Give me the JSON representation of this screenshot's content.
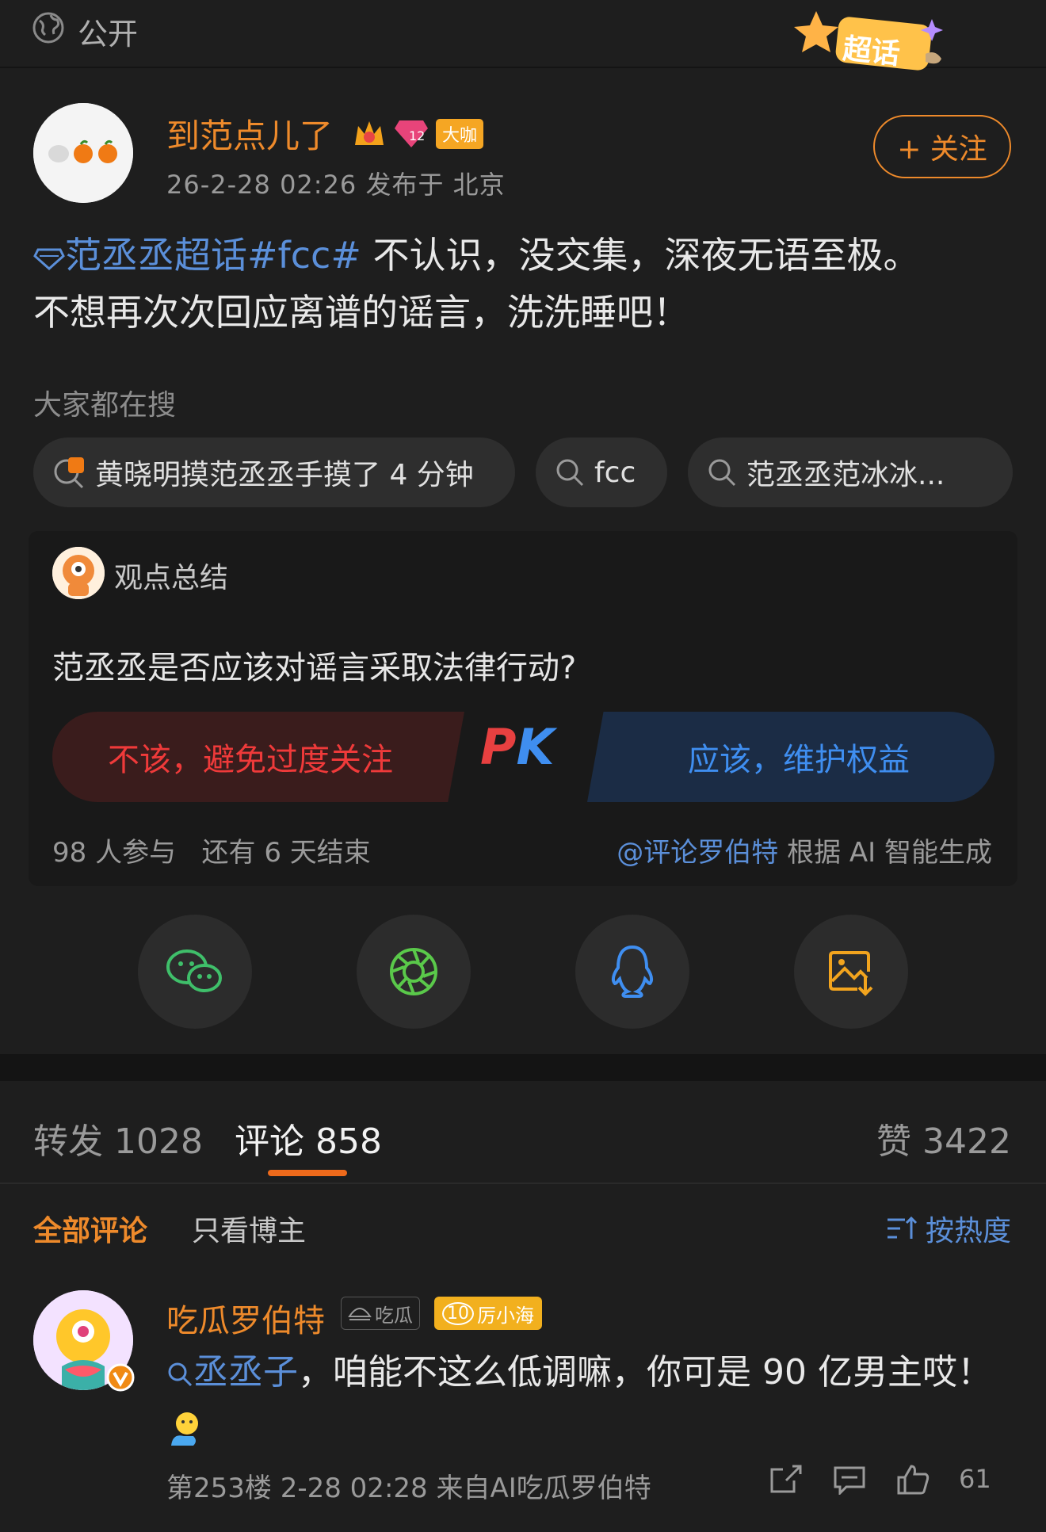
{
  "header": {
    "visibility": "公开",
    "supertopic_badge": "超话"
  },
  "post": {
    "author": "到范点儿了",
    "vip_badge": "大咖",
    "level_badge": "12",
    "meta": "26-2-28 02:26  发布于 北京",
    "follow_label": "+ 关注",
    "topic_link": "范丞丞超话#fcc#",
    "text_line1": " 不认识，没交集，深夜无语至极。",
    "text_line2": "不想再次次回应离谱的谣言，洗洗睡吧！"
  },
  "search": {
    "heading": "大家都在搜",
    "chips": [
      {
        "label": "黄晓明摸范丞丞手摸了 4 分钟",
        "hot": true
      },
      {
        "label": "fcc",
        "hot": false
      },
      {
        "label": "范丞丞范冰冰...",
        "hot": false
      }
    ]
  },
  "summary": {
    "title": "观点总结",
    "question": "范丞丞是否应该对谣言采取法律行动?",
    "left_option": "不该，避免过度关注",
    "right_option": "应该，维护权益",
    "pk_p": "P",
    "pk_k": "K",
    "participants": "98 人参与",
    "remaining": "还有 6 天结束",
    "source_at": "@评论罗伯特",
    "source_suffix": " 根据 AI 智能生成"
  },
  "share": [
    "wechat-icon",
    "moments-icon",
    "qq-icon",
    "save-image-icon"
  ],
  "tabs": {
    "repost": "转发 1028",
    "comment": "评论 858",
    "like": "赞 3422"
  },
  "filter": {
    "all": "全部评论",
    "owner_only": "只看博主",
    "sort": "按热度"
  },
  "comment": {
    "author": "吃瓜罗伯特",
    "tag1": "吃瓜",
    "tag2_level": "10",
    "tag2": "厉小海",
    "link": "丞丞子",
    "text": "，咱能不这么低调嘛，你可是 90 亿男主哎！",
    "meta": "第253楼  2-28 02:28  来自AI吃瓜罗伯特",
    "likes": "61"
  },
  "colors": {
    "accent": "#ee8a2b",
    "link": "#5b8fd9",
    "pk_red": "#ef3a3a",
    "pk_blue": "#3f8ef0",
    "bg": "#1e1e1e"
  }
}
